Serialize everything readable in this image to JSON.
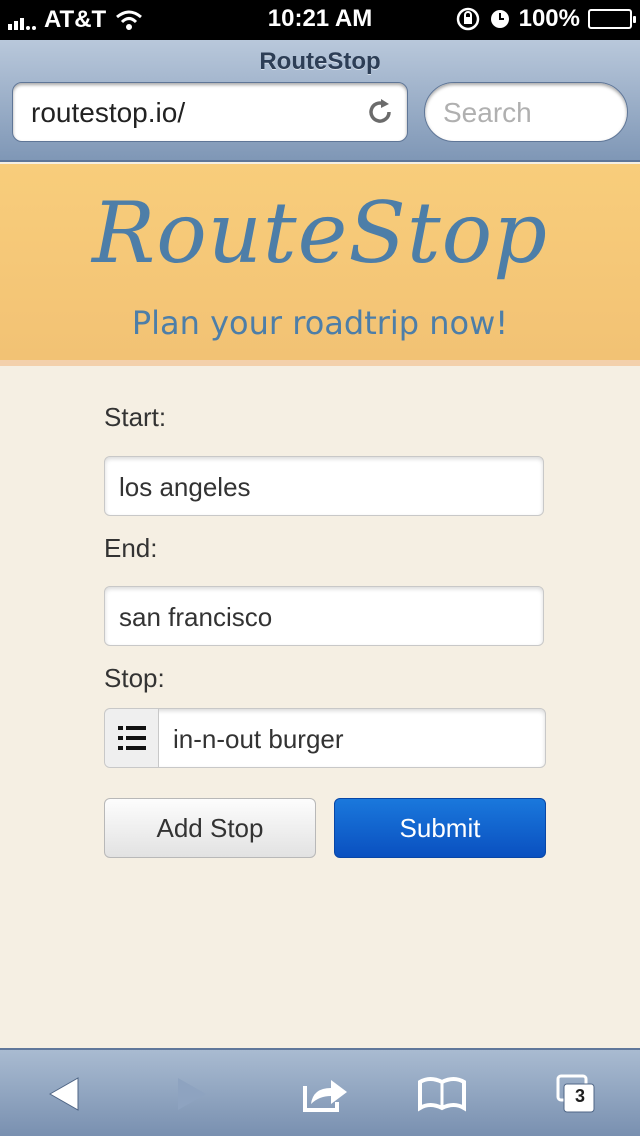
{
  "status_bar": {
    "carrier": "AT&T",
    "time": "10:21 AM",
    "battery": "100%"
  },
  "browser": {
    "page_title": "RouteStop",
    "url": "routestop.io/",
    "search_placeholder": "Search",
    "tab_count": "3"
  },
  "banner": {
    "logo": "RouteStop",
    "tagline": "Plan your roadtrip now!"
  },
  "form": {
    "start_label": "Start:",
    "start_value": "los angeles",
    "end_label": "End:",
    "end_value": "san francisco",
    "stop_label": "Stop:",
    "stop_value": "in-n-out burger",
    "add_stop_label": "Add Stop",
    "submit_label": "Submit"
  },
  "icons": {
    "reload": "reload-icon",
    "list": "list-icon",
    "back": "back-arrow-icon",
    "forward": "forward-arrow-icon",
    "share": "share-icon",
    "bookmarks": "bookmarks-icon",
    "tabs": "tabs-icon"
  },
  "colors": {
    "brand_blue": "#4d7ea8",
    "banner_bg": "#f8cd7b",
    "page_bg": "#f5efe3",
    "submit_bg": "#0a5fd0"
  }
}
